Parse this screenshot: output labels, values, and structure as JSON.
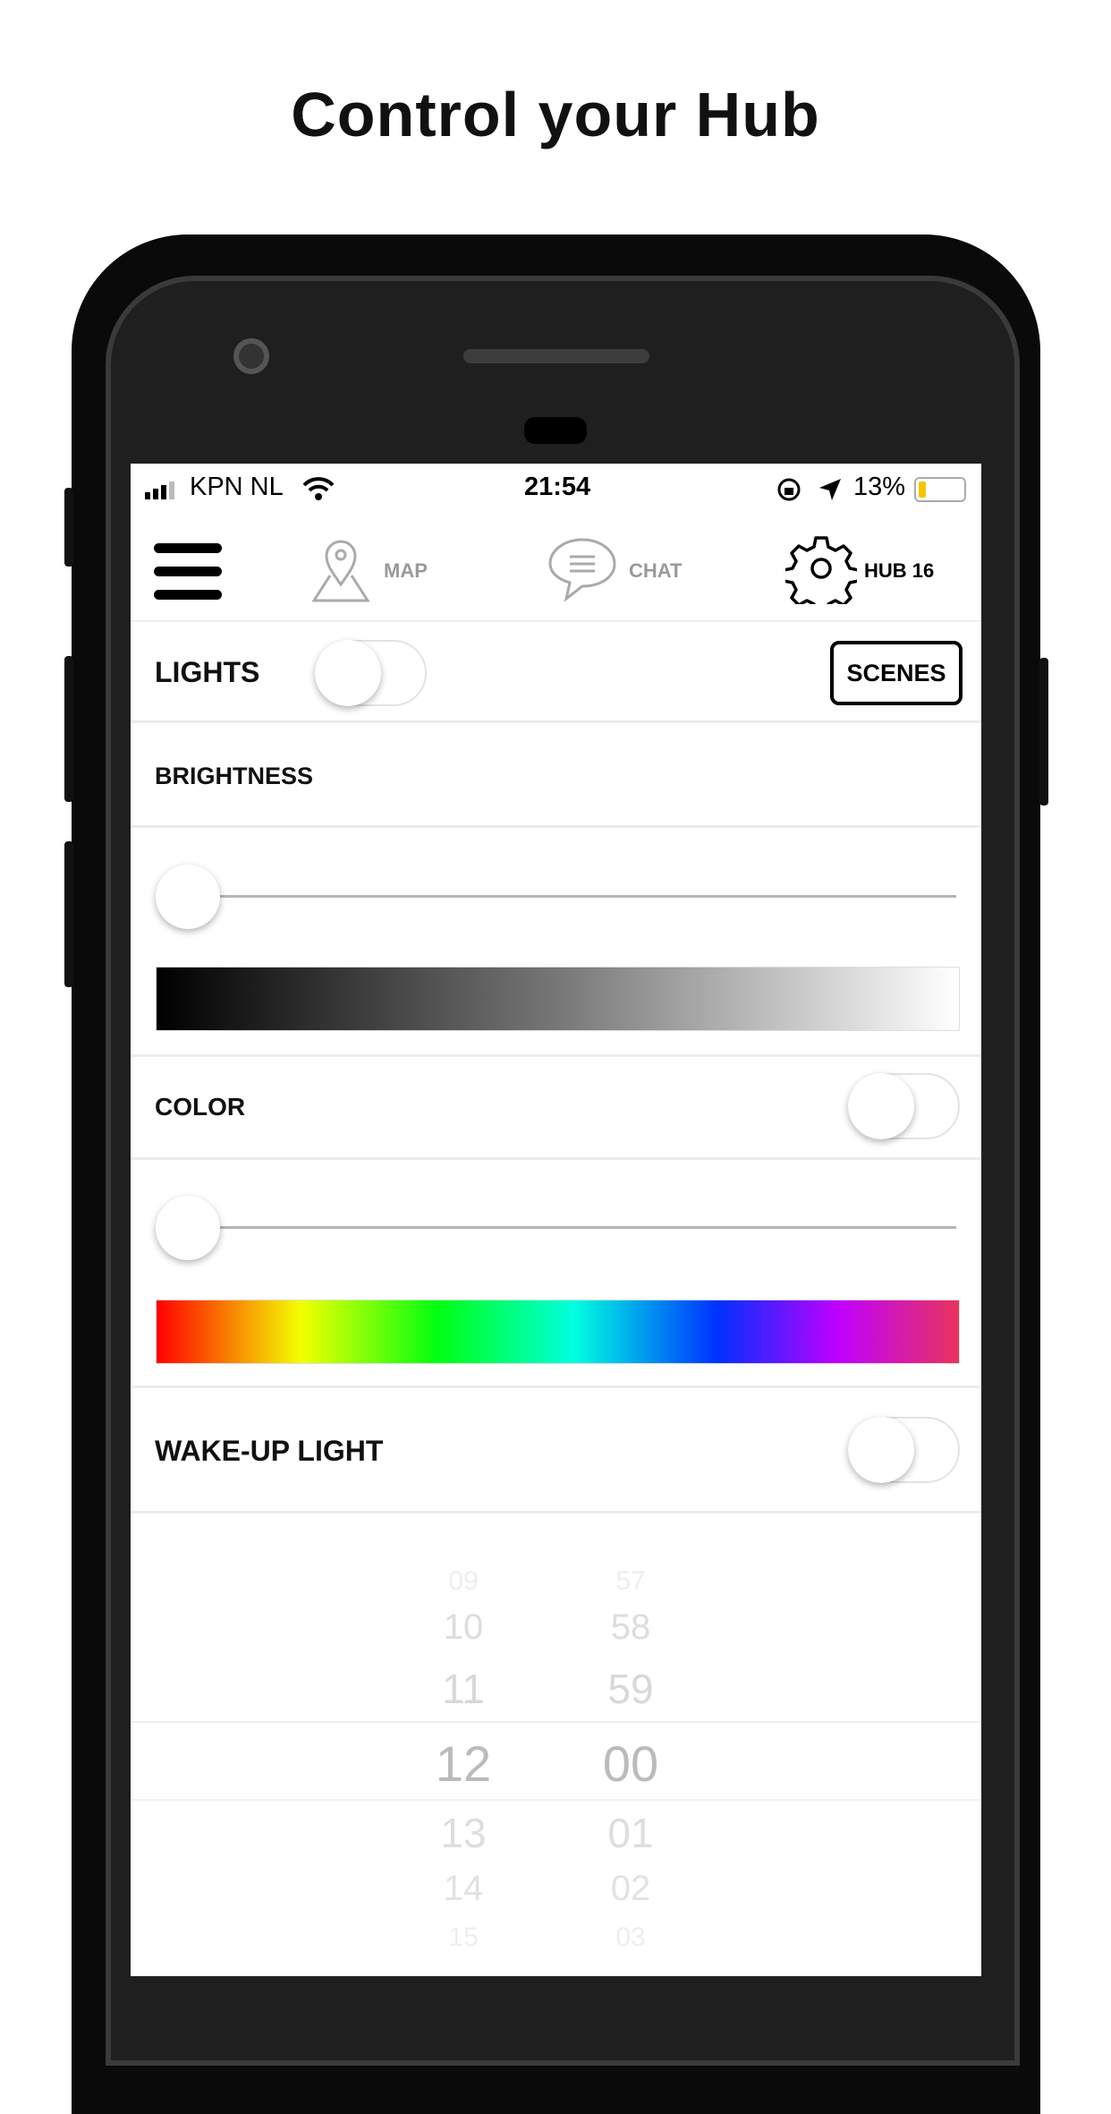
{
  "headline": "Control your Hub",
  "status": {
    "carrier": "KPN NL",
    "time": "21:54",
    "battery": "13%",
    "battery_color": "#f5c400"
  },
  "nav": {
    "map": "MAP",
    "chat": "CHAT",
    "hub": "HUB 16"
  },
  "lights": {
    "label": "LIGHTS",
    "on": false,
    "scenes": "SCENES"
  },
  "brightness": {
    "label": "BRIGHTNESS",
    "value": 0
  },
  "color": {
    "label": "COLOR",
    "on": false,
    "value": 0
  },
  "wakeup": {
    "label": "WAKE-UP LIGHT",
    "on": false
  },
  "picker": {
    "hours": [
      "09",
      "10",
      "11",
      "12",
      "13",
      "14",
      "15"
    ],
    "minutes": [
      "57",
      "58",
      "59",
      "00",
      "01",
      "02",
      "03"
    ],
    "selected_hour": "12",
    "selected_minute": "00"
  }
}
